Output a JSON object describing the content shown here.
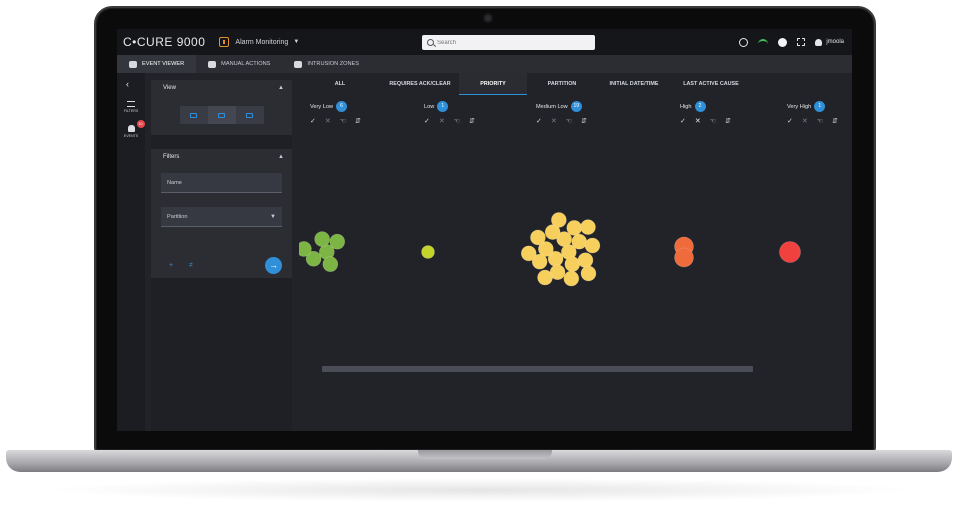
{
  "header": {
    "brand": "C•CURE 9000",
    "app_title": "Alarm Monitoring",
    "search_placeholder": "Search",
    "user": "jmoola"
  },
  "main_tabs": [
    {
      "label": "EVENT VIEWER",
      "active": true,
      "icon": "alarm-icon"
    },
    {
      "label": "MANUAL ACTIONS",
      "active": false,
      "icon": "hand-icon"
    },
    {
      "label": "INTRUSION ZONES",
      "active": false,
      "icon": "zone-icon"
    }
  ],
  "rail": {
    "filters_label": "FILTERS",
    "events_label": "EVENTS",
    "events_badge": "10"
  },
  "view_card": {
    "title": "View"
  },
  "filters_card": {
    "title": "Filters",
    "name_placeholder": "Name",
    "partition_label": "Partition"
  },
  "column_tabs": [
    {
      "label": "ALL",
      "active": false
    },
    {
      "label": "REQUIRES ACK/CLEAR",
      "active": false
    },
    {
      "label": "PRIORITY",
      "active": true
    },
    {
      "label": "PARTITION",
      "active": false
    },
    {
      "label": "INITIAL DATE/TIME",
      "active": false
    },
    {
      "label": "LAST ACTIVE CAUSE",
      "active": false
    }
  ],
  "priority_groups": [
    {
      "name": "Very Low",
      "count": "6",
      "color": "#7db544",
      "bubbles": 6
    },
    {
      "name": "Low",
      "count": "1",
      "color": "#c5d42b",
      "bubbles": 1
    },
    {
      "name": "Medium Low",
      "count": "19",
      "color": "#f7cf5c",
      "bubbles": 19
    },
    {
      "name": "High",
      "count": "2",
      "color": "#f06b3c",
      "bubbles": 2
    },
    {
      "name": "Very High",
      "count": "1",
      "color": "#f0413f",
      "bubbles": 1
    }
  ],
  "colors": {
    "accent": "#2f8fd8",
    "screen_bg": "#222328",
    "badge": "#e5484d"
  }
}
